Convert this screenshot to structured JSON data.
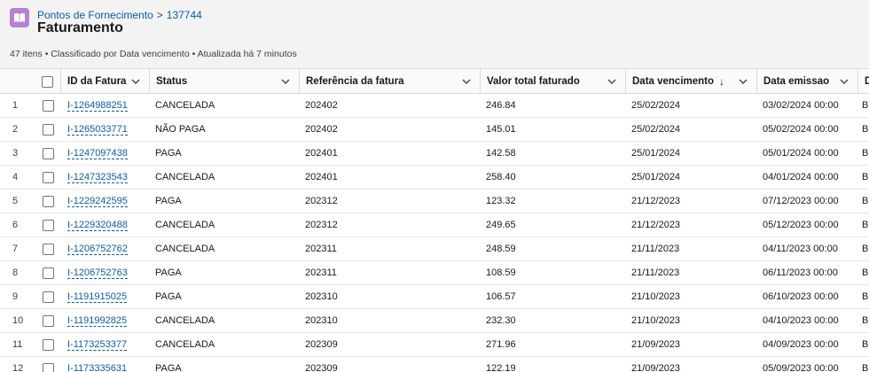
{
  "header": {
    "app_icon": "book-icon",
    "breadcrumb_parent": "Pontos de Fornecimento",
    "breadcrumb_separator": ">",
    "breadcrumb_record": "137744",
    "title": "Faturamento",
    "summary": "47 itens • Classificado por Data vencimento • Atualizada há 7 minutos"
  },
  "table": {
    "columns": {
      "id": "ID da Fatura",
      "status": "Status",
      "reference": "Referência da fatura",
      "total": "Valor total faturado",
      "due": "Data vencimento",
      "due_sort": "↓",
      "issued": "Data emissao",
      "extra": "D"
    },
    "rows": [
      {
        "n": "1",
        "id": "I-1264988251",
        "status": "CANCELADA",
        "ref": "202402",
        "total": "246.84",
        "due": "25/02/2024",
        "issued": "03/02/2024 00:00",
        "extra": "BI"
      },
      {
        "n": "2",
        "id": "I-1265033771",
        "status": "NÃO PAGA",
        "ref": "202402",
        "total": "145.01",
        "due": "25/02/2024",
        "issued": "05/02/2024 00:00",
        "extra": "BI"
      },
      {
        "n": "3",
        "id": "I-1247097438",
        "status": "PAGA",
        "ref": "202401",
        "total": "142.58",
        "due": "25/01/2024",
        "issued": "05/01/2024 00:00",
        "extra": "BI"
      },
      {
        "n": "4",
        "id": "I-1247323543",
        "status": "CANCELADA",
        "ref": "202401",
        "total": "258.40",
        "due": "25/01/2024",
        "issued": "04/01/2024 00:00",
        "extra": "BI"
      },
      {
        "n": "5",
        "id": "I-1229242595",
        "status": "PAGA",
        "ref": "202312",
        "total": "123.32",
        "due": "21/12/2023",
        "issued": "07/12/2023 00:00",
        "extra": "BI"
      },
      {
        "n": "6",
        "id": "I-1229320488",
        "status": "CANCELADA",
        "ref": "202312",
        "total": "249.65",
        "due": "21/12/2023",
        "issued": "05/12/2023 00:00",
        "extra": "BI"
      },
      {
        "n": "7",
        "id": "I-1206752762",
        "status": "CANCELADA",
        "ref": "202311",
        "total": "248.59",
        "due": "21/11/2023",
        "issued": "04/11/2023 00:00",
        "extra": "BI"
      },
      {
        "n": "8",
        "id": "I-1206752763",
        "status": "PAGA",
        "ref": "202311",
        "total": "108.59",
        "due": "21/11/2023",
        "issued": "06/11/2023 00:00",
        "extra": "BI"
      },
      {
        "n": "9",
        "id": "I-1191915025",
        "status": "PAGA",
        "ref": "202310",
        "total": "106.57",
        "due": "21/10/2023",
        "issued": "06/10/2023 00:00",
        "extra": "BI"
      },
      {
        "n": "10",
        "id": "I-1191992825",
        "status": "CANCELADA",
        "ref": "202310",
        "total": "232.30",
        "due": "21/10/2023",
        "issued": "04/10/2023 00:00",
        "extra": "BI"
      },
      {
        "n": "11",
        "id": "I-1173253377",
        "status": "CANCELADA",
        "ref": "202309",
        "total": "271.96",
        "due": "21/09/2023",
        "issued": "04/09/2023 00:00",
        "extra": "BI"
      },
      {
        "n": "12",
        "id": "I-1173335631",
        "status": "PAGA",
        "ref": "202309",
        "total": "122.19",
        "due": "21/09/2023",
        "issued": "05/09/2023 00:00",
        "extra": "BI"
      }
    ]
  }
}
